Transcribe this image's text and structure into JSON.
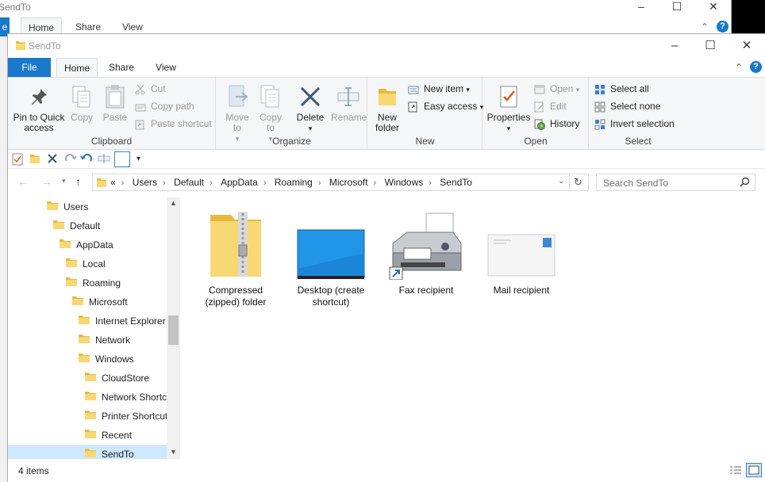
{
  "background_window": {
    "title": "SendTo",
    "tabs": [
      "e",
      "Home",
      "Share",
      "View"
    ],
    "controls": [
      "–",
      "☐",
      "✕"
    ]
  },
  "window": {
    "title": "SendTo",
    "controls": [
      "–",
      "☐",
      "✕"
    ]
  },
  "tabs": {
    "file": "File",
    "home": "Home",
    "share": "Share",
    "view": "View"
  },
  "ribbon": {
    "clipboard": {
      "label": "Clipboard",
      "pin": "Pin to Quick access",
      "copy": "Copy",
      "paste": "Paste",
      "cut": "Cut",
      "copy_path": "Copy path",
      "paste_shortcut": "Paste shortcut"
    },
    "organize": {
      "label": "Organize",
      "move_to": "Move to",
      "copy_to": "Copy to",
      "delete": "Delete",
      "rename": "Rename"
    },
    "new": {
      "label": "New",
      "new_folder": "New folder",
      "new_item": "New item",
      "easy_access": "Easy access"
    },
    "open": {
      "label": "Open",
      "properties": "Properties",
      "open": "Open",
      "edit": "Edit",
      "history": "History"
    },
    "select": {
      "label": "Select",
      "select_all": "Select all",
      "select_none": "Select none",
      "invert": "Invert selection"
    }
  },
  "address": {
    "overflow": "«",
    "crumbs": [
      "Users",
      "Default",
      "AppData",
      "Roaming",
      "Microsoft",
      "Windows",
      "SendTo"
    ]
  },
  "search": {
    "placeholder": "Search SendTo"
  },
  "nav_tree": [
    {
      "label": "Users"
    },
    {
      "label": "Default"
    },
    {
      "label": "AppData"
    },
    {
      "label": "Local"
    },
    {
      "label": "Roaming"
    },
    {
      "label": "Microsoft"
    },
    {
      "label": "Internet Explorer"
    },
    {
      "label": "Network"
    },
    {
      "label": "Windows"
    },
    {
      "label": "CloudStore"
    },
    {
      "label": "Network Shortc"
    },
    {
      "label": "Printer Shortcut"
    },
    {
      "label": "Recent"
    },
    {
      "label": "SendTo"
    }
  ],
  "files": [
    {
      "name": "Compressed (zipped) folder",
      "line1": "Compressed",
      "line2": "(zipped) folder",
      "icon": "zip-folder-icon"
    },
    {
      "name": "Desktop (create shortcut)",
      "line1": "Desktop (create",
      "line2": "shortcut)",
      "icon": "desktop-icon"
    },
    {
      "name": "Fax recipient",
      "line1": "Fax recipient",
      "line2": "",
      "icon": "fax-icon"
    },
    {
      "name": "Mail recipient",
      "line1": "Mail recipient",
      "line2": "",
      "icon": "mail-icon"
    }
  ],
  "status": {
    "count": "4 items"
  },
  "colors": {
    "accent": "#1979ca",
    "ribbon_bg": "#f5f6f7",
    "folder": "#f8d775",
    "selection": "#cde8ff"
  }
}
